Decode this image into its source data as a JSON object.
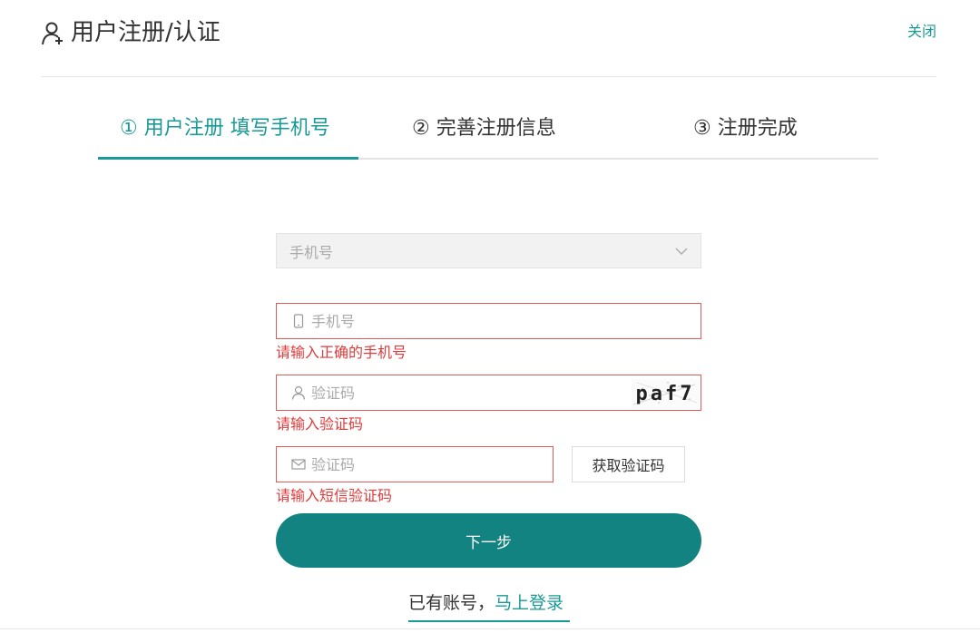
{
  "header": {
    "title": "用户注册/认证",
    "close_label": "关闭",
    "icon": "user-plus-icon"
  },
  "steps": [
    {
      "label": "① 用户注册 填写手机号",
      "active": true
    },
    {
      "label": "② 完善注册信息",
      "active": false
    },
    {
      "label": "③ 注册完成",
      "active": false
    }
  ],
  "form": {
    "select": {
      "value": "手机号",
      "icon": "chevron-down-icon"
    },
    "phone": {
      "placeholder": "手机号",
      "value": "",
      "icon": "mobile-icon",
      "error": "请输入正确的手机号"
    },
    "captcha": {
      "placeholder": "验证码",
      "value": "",
      "icon": "user-icon",
      "image_text": "paf7",
      "error": "请输入验证码"
    },
    "sms": {
      "placeholder": "验证码",
      "value": "",
      "icon": "mail-icon",
      "error": "请输入短信验证码",
      "button_label": "获取验证码"
    },
    "next_label": "下一步"
  },
  "login": {
    "prefix": "已有账号，",
    "link": "马上登录"
  },
  "colors": {
    "accent": "#1a9a96",
    "button": "#128381",
    "error": "#e03a3a",
    "error_border": "#e05a5a"
  }
}
